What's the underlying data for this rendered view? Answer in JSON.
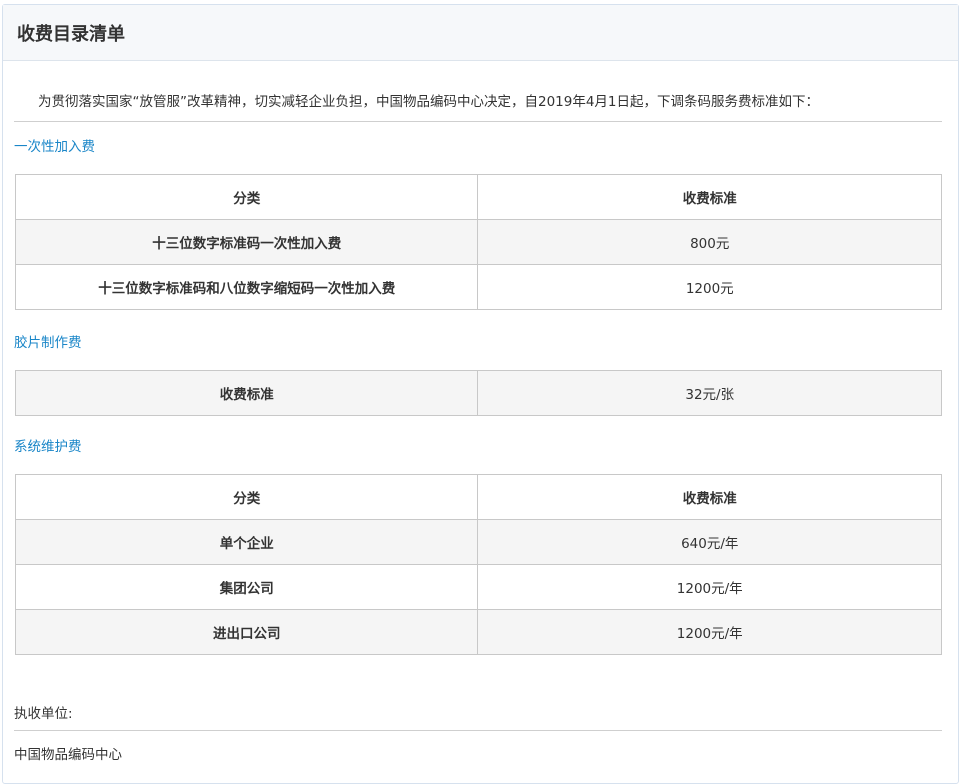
{
  "header": {
    "title": "收费目录清单"
  },
  "intro": "为贯彻落实国家“放管服”改革精神，切实减轻企业负担，中国物品编码中心决定，自2019年4月1日起，下调条码服务费标准如下：",
  "sections": [
    {
      "title": "一次性加入费",
      "headers": [
        "分类",
        "收费标准"
      ],
      "rows": [
        {
          "label": "十三位数字标准码一次性加入费",
          "value": "800元"
        },
        {
          "label": "十三位数字标准码和八位数字缩短码一次性加入费",
          "value": "1200元"
        }
      ]
    },
    {
      "title": "胶片制作费",
      "rows": [
        {
          "label": "收费标准",
          "value": "32元/张"
        }
      ]
    },
    {
      "title": "系统维护费",
      "headers": [
        "分类",
        "收费标准"
      ],
      "rows": [
        {
          "label": "单个企业",
          "value": "640元/年"
        },
        {
          "label": "集团公司",
          "value": "1200元/年"
        },
        {
          "label": "进出口公司",
          "value": "1200元/年"
        }
      ]
    }
  ],
  "footer": {
    "label": "执收单位:",
    "value": "中国物品编码中心"
  }
}
